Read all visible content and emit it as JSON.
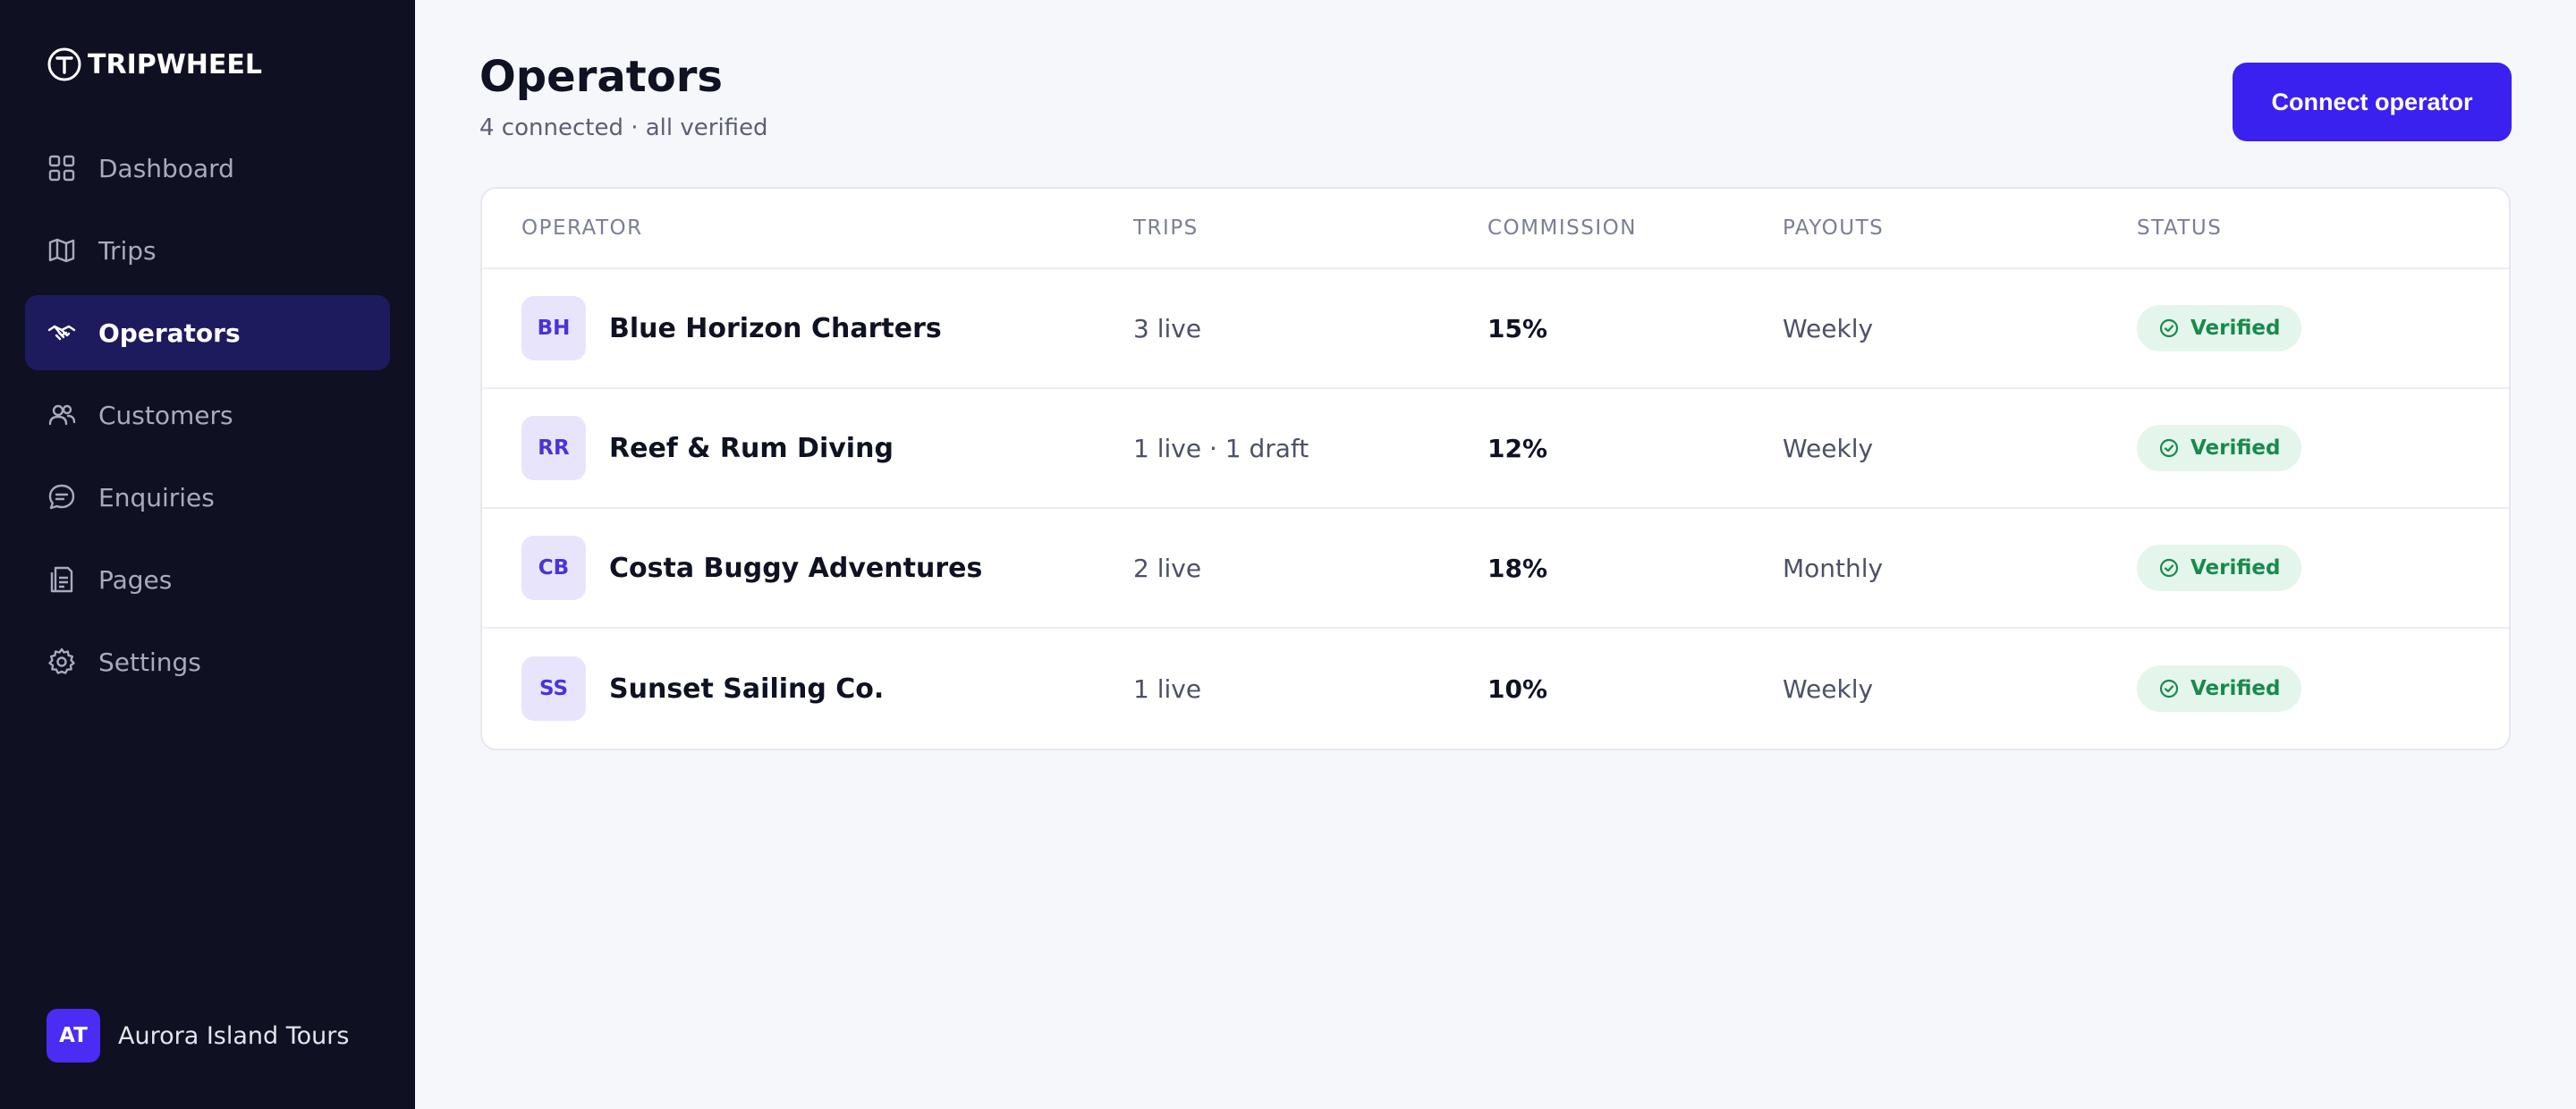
{
  "sidebar": {
    "brand": "TRIPWHEEL",
    "items": [
      {
        "label": "Dashboard",
        "icon": "grid-icon"
      },
      {
        "label": "Trips",
        "icon": "map-icon"
      },
      {
        "label": "Operators",
        "icon": "handshake-icon",
        "active": true
      },
      {
        "label": "Customers",
        "icon": "users-icon"
      },
      {
        "label": "Enquiries",
        "icon": "chat-icon"
      },
      {
        "label": "Pages",
        "icon": "pages-icon"
      },
      {
        "label": "Settings",
        "icon": "gear-icon"
      }
    ],
    "account": {
      "initials": "AT",
      "name": "Aurora Island Tours"
    }
  },
  "header": {
    "title": "Operators",
    "subtitle": "4 connected · all verified",
    "primary_action": "Connect operator"
  },
  "table": {
    "columns": [
      "OPERATOR",
      "TRIPS",
      "COMMISSION",
      "PAYOUTS",
      "STATUS"
    ],
    "rows": [
      {
        "initials": "BH",
        "name": "Blue Horizon Charters",
        "trips": "3 live",
        "commission": "15%",
        "payouts": "Weekly",
        "status": "Verified"
      },
      {
        "initials": "RR",
        "name": "Reef & Rum Diving",
        "trips": "1 live · 1 draft",
        "commission": "12%",
        "payouts": "Weekly",
        "status": "Verified"
      },
      {
        "initials": "CB",
        "name": "Costa Buggy Adventures",
        "trips": "2 live",
        "commission": "18%",
        "payouts": "Monthly",
        "status": "Verified"
      },
      {
        "initials": "SS",
        "name": "Sunset Sailing Co.",
        "trips": "1 live",
        "commission": "10%",
        "payouts": "Weekly",
        "status": "Verified"
      }
    ]
  },
  "colors": {
    "sidebar_bg": "#0f1021",
    "active_nav_bg": "#1e1a5e",
    "accent": "#3a21f0",
    "verified_bg": "#e4f5ec",
    "verified_text": "#198a4c"
  }
}
